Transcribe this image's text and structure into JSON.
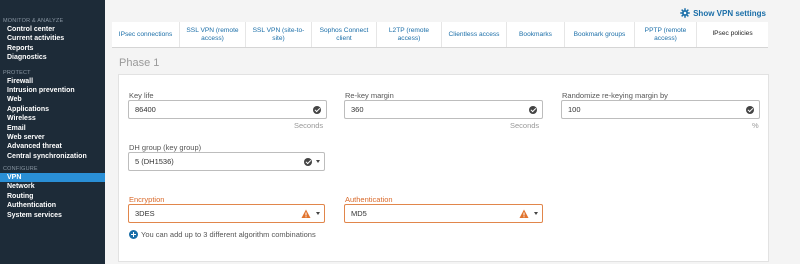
{
  "sidebar": {
    "sections": [
      {
        "title": "MONITOR & ANALYZE",
        "items": [
          "Control center",
          "Current activities",
          "Reports",
          "Diagnostics"
        ]
      },
      {
        "title": "PROTECT",
        "items": [
          "Firewall",
          "Intrusion prevention",
          "Web",
          "Applications",
          "Wireless",
          "Email",
          "Web server",
          "Advanced threat",
          "Central synchronization"
        ]
      },
      {
        "title": "CONFIGURE",
        "items": [
          "VPN",
          "Network",
          "Routing",
          "Authentication",
          "System services"
        ]
      }
    ],
    "active": "VPN"
  },
  "header": {
    "vpn_link": "Show VPN settings"
  },
  "tabs": [
    "IPsec connections",
    "SSL VPN (remote access)",
    "SSL VPN (site-to-site)",
    "Sophos Connect client",
    "L2TP (remote access)",
    "Clientless access",
    "Bookmarks",
    "Bookmark groups",
    "PPTP (remote access)",
    "IPsec policies"
  ],
  "active_tab": "IPsec policies",
  "phase": {
    "title": "Phase 1",
    "key_life": {
      "label": "Key life",
      "value": "86400",
      "unit": "Seconds"
    },
    "rekey_margin": {
      "label": "Re-key margin",
      "value": "360",
      "unit": "Seconds"
    },
    "randomize": {
      "label": "Randomize re-keying margin by",
      "value": "100",
      "unit": "%"
    },
    "dh_group": {
      "label": "DH group (key group)",
      "value": "5 (DH1536)"
    },
    "encryption": {
      "label": "Encryption",
      "value": "3DES"
    },
    "authentication": {
      "label": "Authentication",
      "value": "MD5"
    },
    "note": "You can add up to 3 different algorithm combinations"
  },
  "colors": {
    "sidebar_bg": "#1d2b38",
    "active_blue": "#2a8fd6",
    "link_blue": "#1a6ea8",
    "warning_orange": "#d9692a"
  }
}
